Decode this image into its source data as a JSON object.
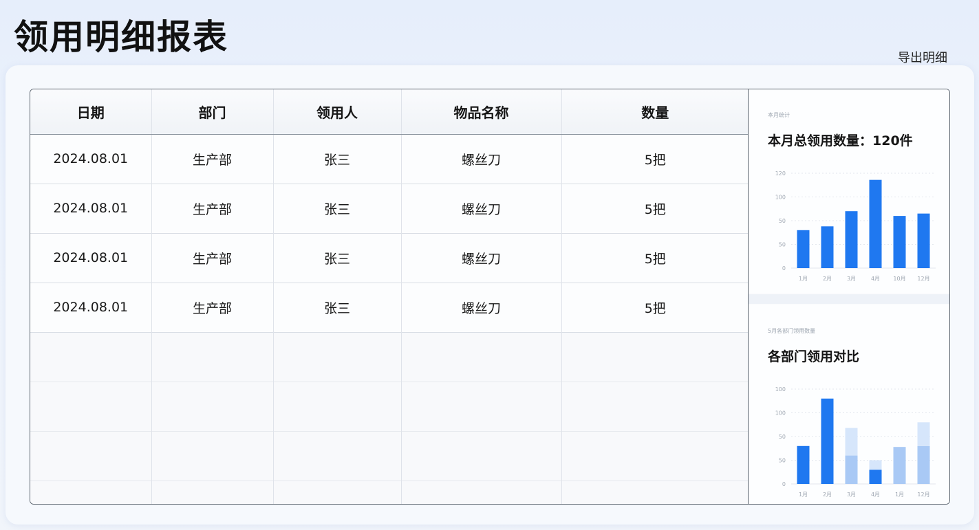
{
  "page": {
    "title": "领用明细报表",
    "export_label": "导出明细"
  },
  "table": {
    "headers": [
      "日期",
      "部门",
      "领用人",
      "物品名称",
      "数量"
    ],
    "rows": [
      [
        "2024.08.01",
        "生产部",
        "张三",
        "螺丝刀",
        "5把"
      ],
      [
        "2024.08.01",
        "生产部",
        "张三",
        "螺丝刀",
        "5把"
      ],
      [
        "2024.08.01",
        "生产部",
        "张三",
        "螺丝刀",
        "5把"
      ],
      [
        "2024.08.01",
        "生产部",
        "张三",
        "螺丝刀",
        "5把"
      ]
    ],
    "empty_rows": 4
  },
  "side": {
    "card1": {
      "caption": "本月统计",
      "title": "本月总领用数量：120件"
    },
    "card2": {
      "caption": "5月各部门领用数量",
      "title": "各部门领用对比"
    }
  },
  "colors": {
    "bar_dark": "#1f78f0",
    "bar_light": "#a9c9f5",
    "bar_pale": "#d6e6fb"
  },
  "chart_data": [
    {
      "type": "bar",
      "categories": [
        "1月",
        "2月",
        "3月",
        "4月",
        "10月",
        "12月"
      ],
      "values": [
        80,
        88,
        120,
        186,
        110,
        115
      ],
      "yticks": [
        0,
        50,
        100,
        150,
        200
      ],
      "ytick_labels": [
        "0",
        "50",
        "50",
        "100",
        "120"
      ],
      "ylim": [
        0,
        200
      ],
      "title": "本月总领用数量：120件",
      "grid": true
    },
    {
      "type": "bar",
      "stacked": true,
      "categories": [
        "1月",
        "2月",
        "3月",
        "4月",
        "1月",
        "12月"
      ],
      "series": [
        {
          "values": [
            80,
            180,
            0,
            30,
            0,
            0
          ],
          "color": "#1f78f0"
        },
        {
          "values": [
            0,
            0,
            60,
            0,
            78,
            80
          ],
          "color": "#a9c9f5"
        },
        {
          "values": [
            0,
            0,
            58,
            20,
            0,
            50
          ],
          "color": "#d6e6fb"
        }
      ],
      "yticks": [
        0,
        50,
        100,
        150,
        200
      ],
      "ytick_labels": [
        "0",
        "50",
        "50",
        "100",
        "100"
      ],
      "ylim": [
        0,
        200
      ],
      "title": "各部门领用对比",
      "grid": true
    }
  ]
}
